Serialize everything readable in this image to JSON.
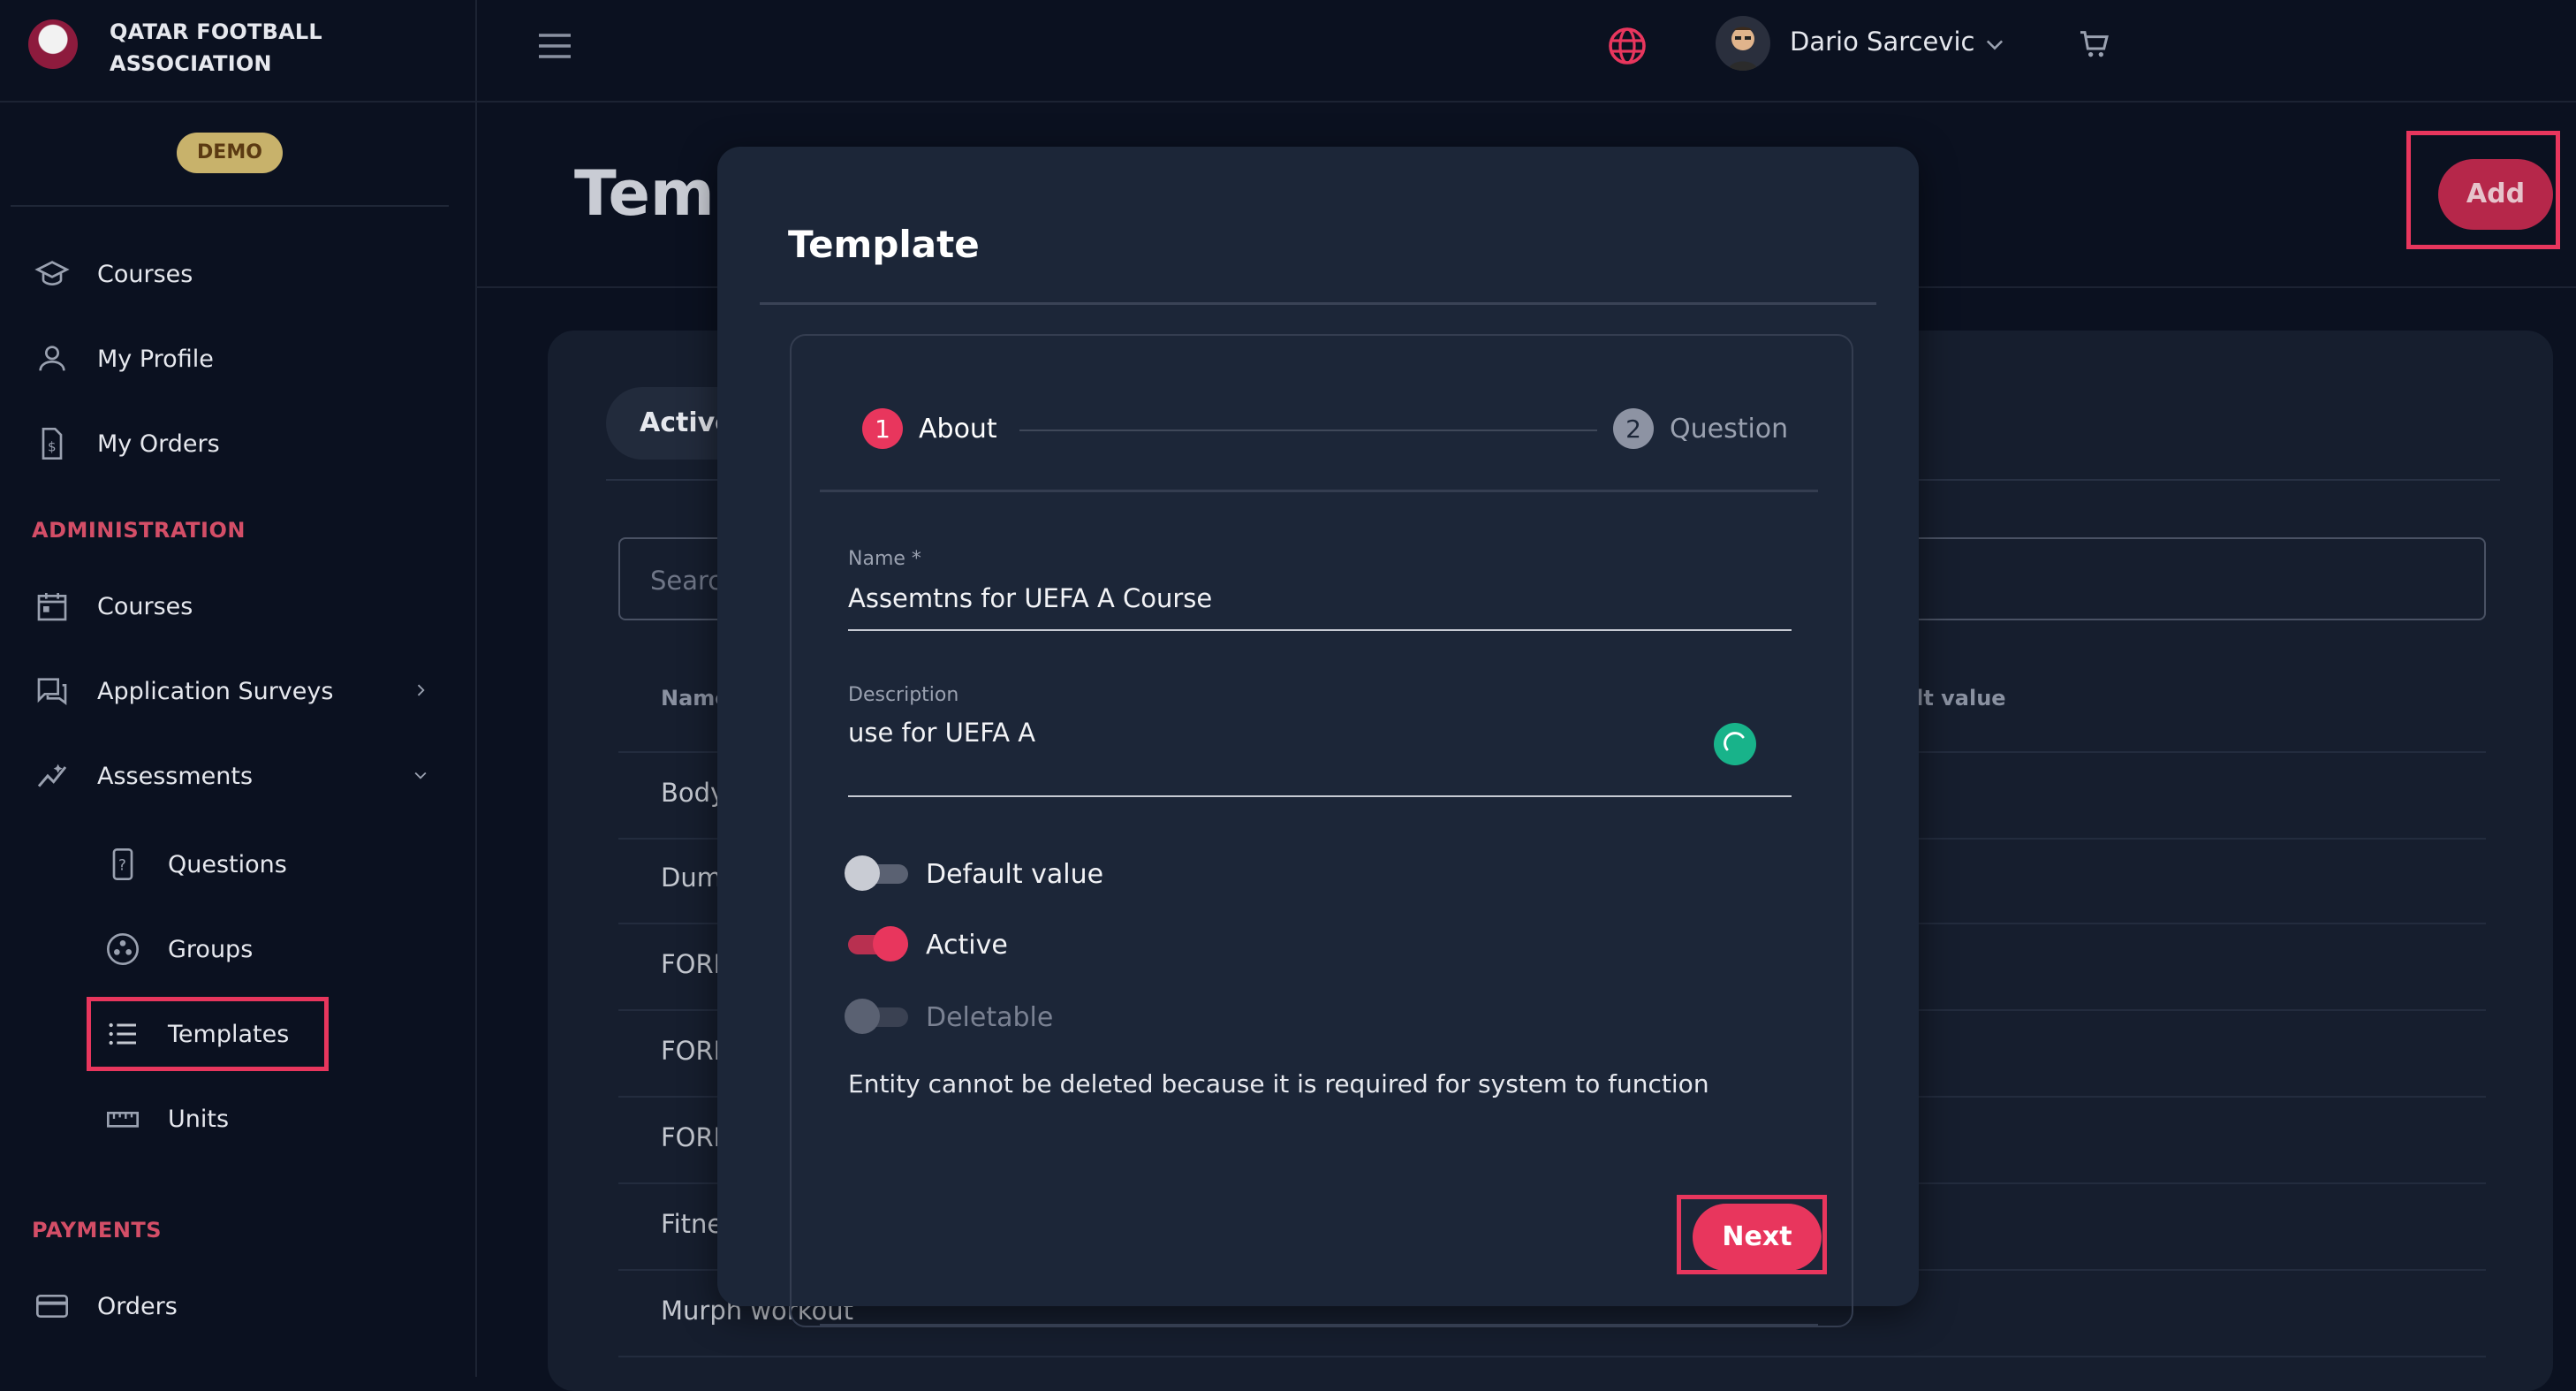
{
  "brand": {
    "name_line1": "QATAR FOOTBALL",
    "name_line2": "ASSOCIATION",
    "badge": "DEMO"
  },
  "sidebar": {
    "items": [
      {
        "label": "Courses",
        "icon": "graduation-cap-icon"
      },
      {
        "label": "My Profile",
        "icon": "user-icon"
      },
      {
        "label": "My Orders",
        "icon": "invoice-icon"
      }
    ],
    "admin_title": "ADMINISTRATION",
    "admin_items": [
      {
        "label": "Courses",
        "icon": "calendar-icon"
      },
      {
        "label": "Application Surveys",
        "icon": "chat-icon"
      },
      {
        "label": "Assessments",
        "icon": "chart-line-icon"
      }
    ],
    "assessment_sub": [
      {
        "label": "Questions",
        "icon": "question-doc-icon"
      },
      {
        "label": "Groups",
        "icon": "groups-icon"
      },
      {
        "label": "Templates",
        "icon": "list-icon"
      },
      {
        "label": "Units",
        "icon": "ruler-icon"
      }
    ],
    "payments_title": "PAYMENTS",
    "payments_items": [
      {
        "label": "Orders",
        "icon": "card-icon"
      }
    ]
  },
  "header": {
    "user_name": "Dario Sarcevic"
  },
  "main": {
    "title": "Temp",
    "add_label": "Add",
    "tab_active": "Active",
    "search_placeholder": "Searc",
    "col_name": "Name",
    "col_default": "ult value",
    "rows": [
      "Body",
      "Dumm",
      "FORM",
      "FORM",
      "FORM",
      "Fitne",
      "Murph workout"
    ]
  },
  "modal": {
    "title": "Template",
    "step1_num": "1",
    "step1_label": "About",
    "step2_num": "2",
    "step2_label": "Question",
    "name_label": "Name *",
    "name_value": "Assemtns for UEFA A  Course",
    "desc_label": "Description",
    "desc_value": "use for UEFA A",
    "toggles": [
      {
        "label": "Default value",
        "on": false,
        "disabled": false
      },
      {
        "label": "Active",
        "on": true,
        "disabled": false
      },
      {
        "label": "Deletable",
        "on": false,
        "disabled": true
      }
    ],
    "note": "Entity cannot be deleted because it is required for system to function",
    "next_label": "Next"
  },
  "colors": {
    "accent": "#e8365d",
    "bg": "#0b1120",
    "modal_bg": "#1c2638",
    "demo_badge": "#c8b26b",
    "section": "#d44e67"
  }
}
